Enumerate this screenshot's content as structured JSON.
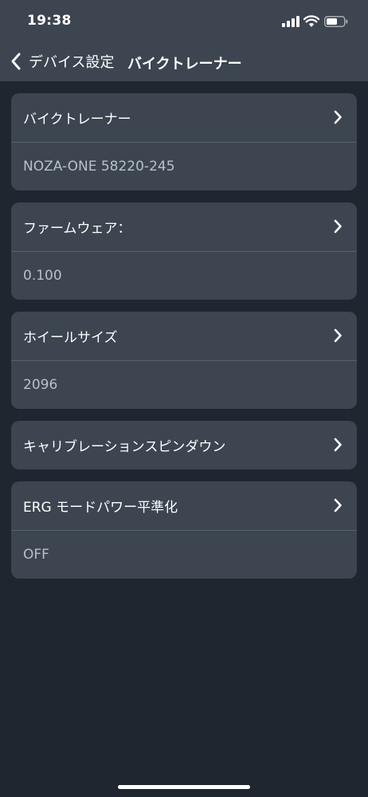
{
  "status_bar": {
    "time": "19:38",
    "icons": [
      "signal-icon",
      "wifi-icon",
      "battery-icon"
    ]
  },
  "nav": {
    "back_label": "デバイス設定",
    "title": "バイクトレーナー"
  },
  "cards": [
    {
      "label": "バイクトレーナー",
      "value": "NOZA-ONE 58220-245"
    },
    {
      "label": "ファームウェア：",
      "value": "0.100"
    },
    {
      "label": "ホイールサイズ",
      "value": "2096"
    },
    {
      "label": "キャリブレーションスピンダウン"
    },
    {
      "label": "ERG モードパワー平準化",
      "value": "OFF"
    }
  ],
  "colors": {
    "background": "#20262f",
    "card": "#3c4550",
    "divider": "#58626e",
    "value_text": "#b8c0c9"
  }
}
